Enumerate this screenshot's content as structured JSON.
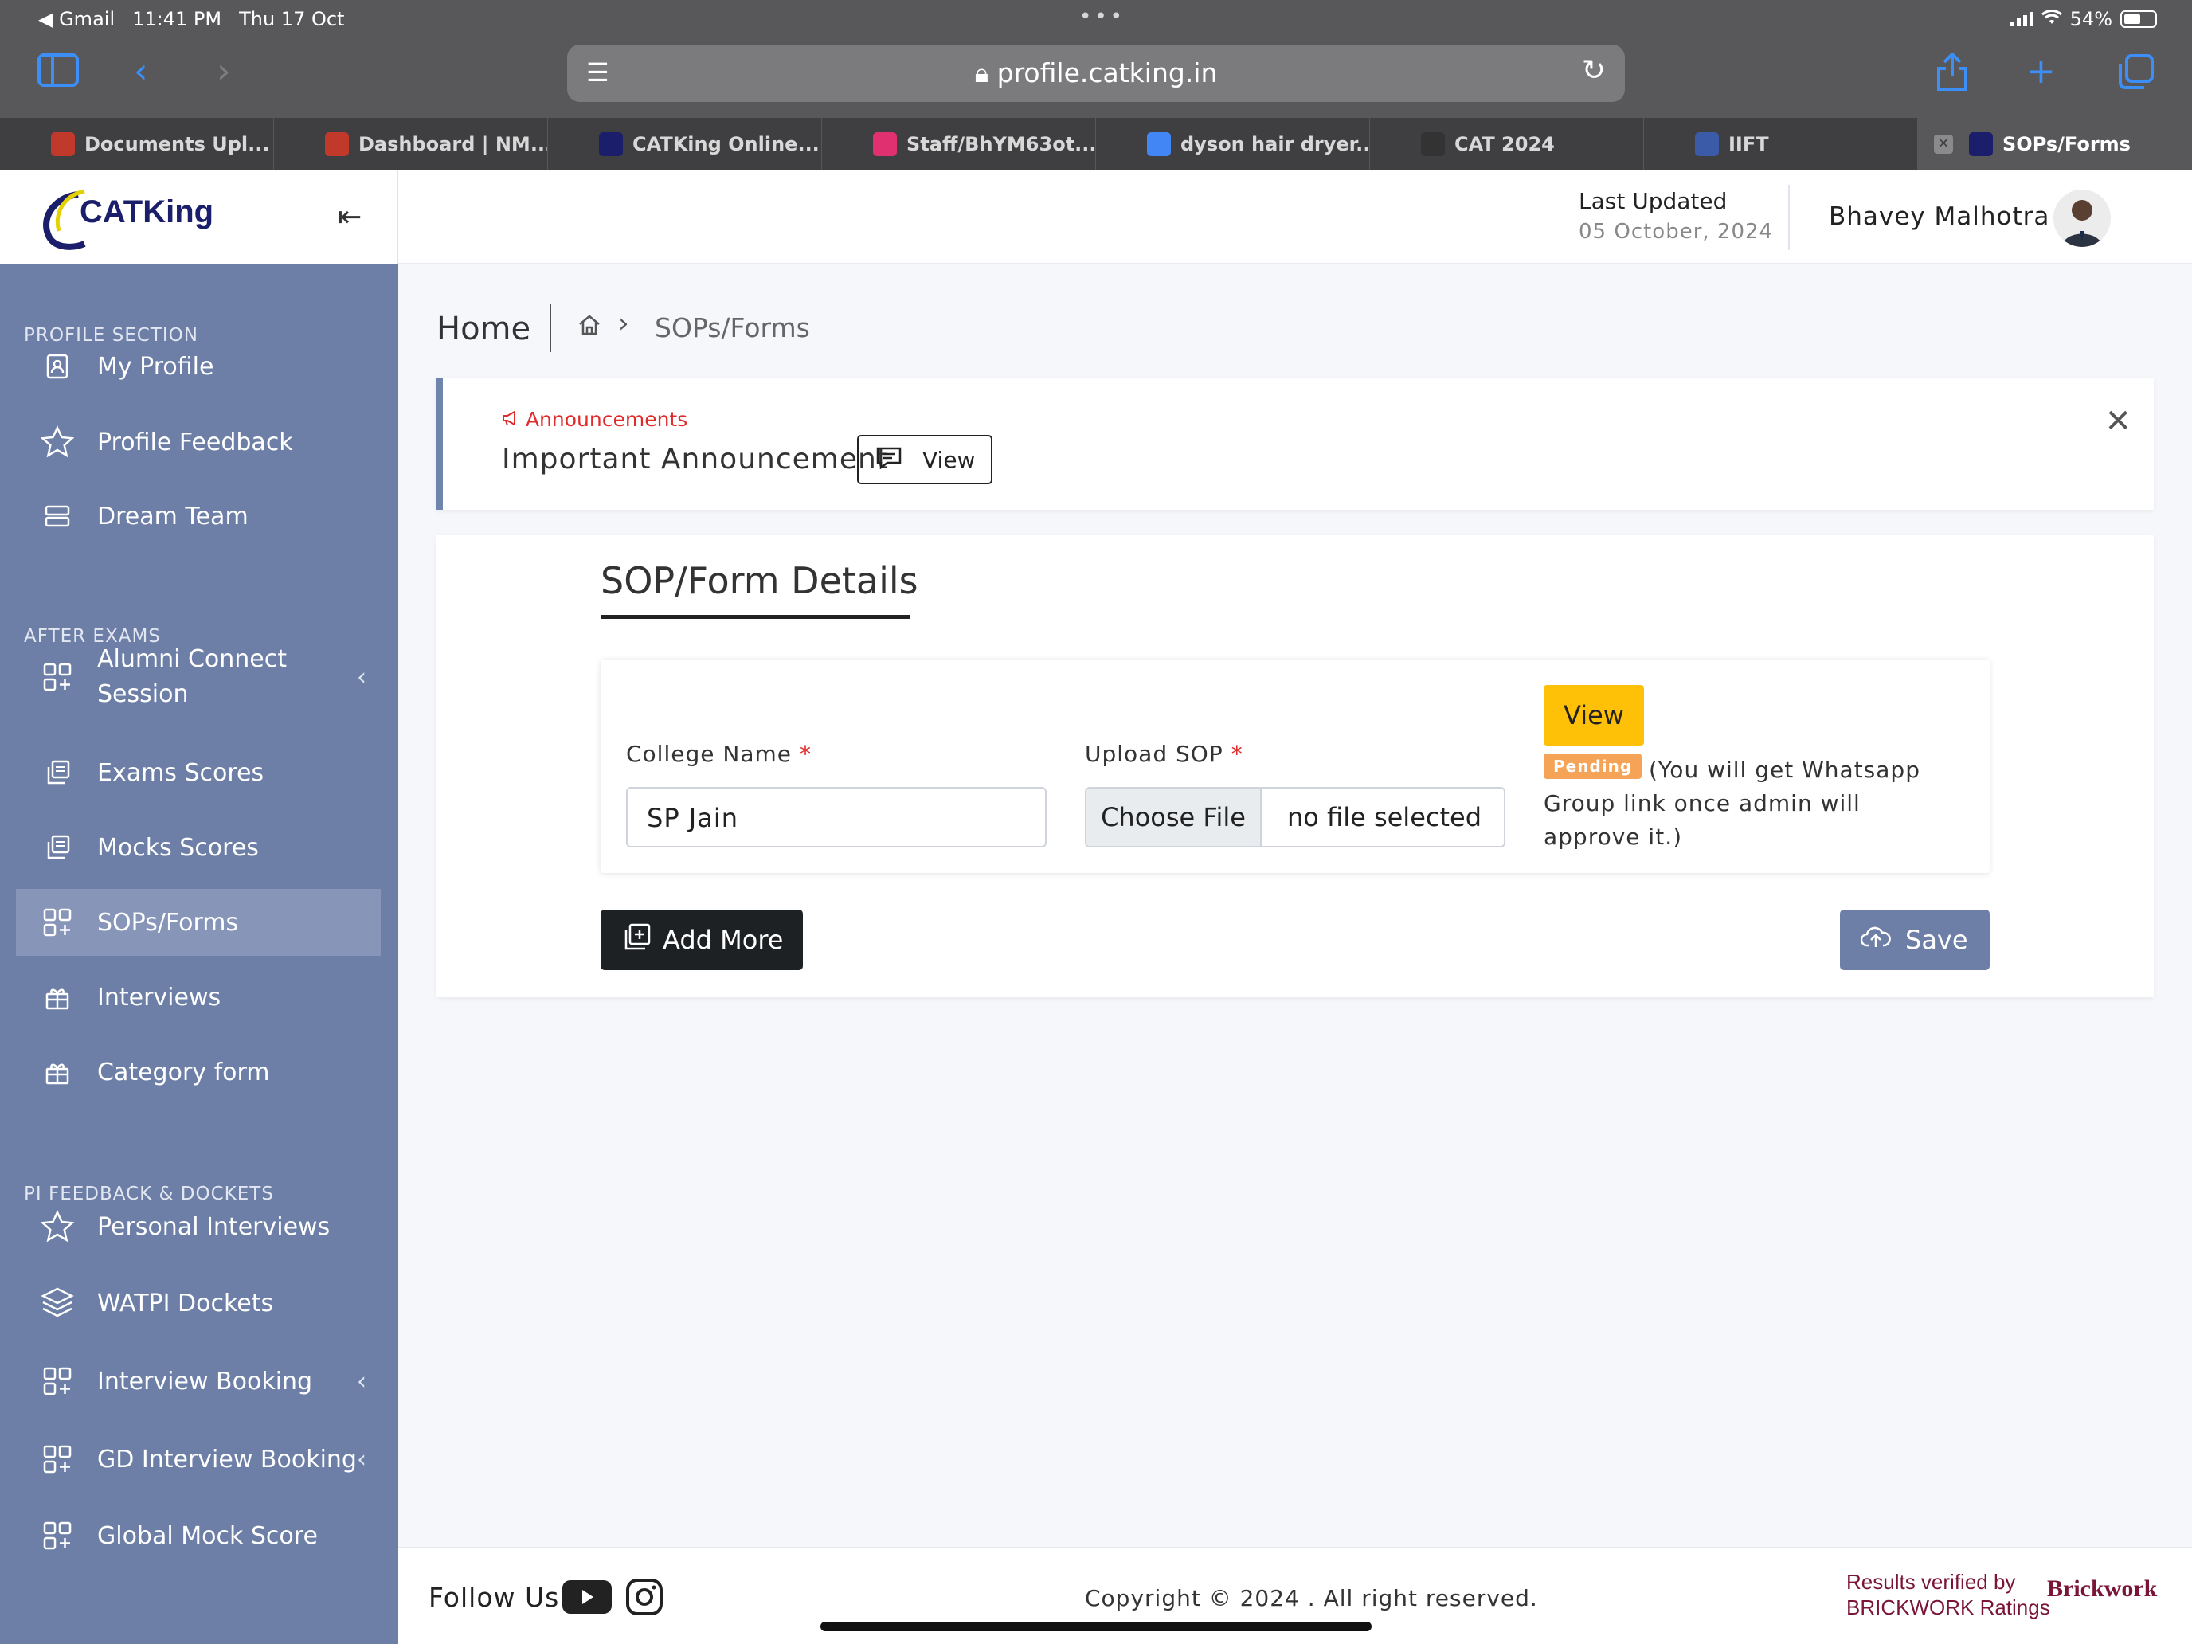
{
  "status_bar": {
    "back_app": "◀ Gmail",
    "time": "11:41 PM",
    "date": "Thu 17 Oct",
    "battery": "54%"
  },
  "browser": {
    "url": "profile.catking.in",
    "tabs": [
      {
        "title": "Documents Upl...",
        "fav_color": "#c0392b"
      },
      {
        "title": "Dashboard | NM...",
        "fav_color": "#c0392b"
      },
      {
        "title": "CATKing Online...",
        "fav_color": "#1b1f6b"
      },
      {
        "title": "Staff/BhYM63ot...",
        "fav_color": "#e0306f"
      },
      {
        "title": "dyson hair dryer...",
        "fav_color": "#4285f4"
      },
      {
        "title": "CAT 2024",
        "fav_color": "#333333"
      },
      {
        "title": "IIFT",
        "fav_color": "#3b5ba9"
      },
      {
        "title": "SOPs/Forms",
        "fav_color": "#1b1f6b",
        "active": true
      }
    ]
  },
  "brand": {
    "logo_text": "CATKing"
  },
  "sidebar": {
    "sections": [
      {
        "title": "PROFILE SECTION"
      },
      {
        "title": "AFTER EXAMS"
      },
      {
        "title": "PI FEEDBACK & DOCKETS"
      }
    ],
    "items": [
      {
        "label": "My Profile",
        "icon": "profile-icon"
      },
      {
        "label": "Profile Feedback",
        "icon": "star-icon"
      },
      {
        "label": "Dream Team",
        "icon": "server-icon"
      },
      {
        "label": "Alumni Connect Session",
        "icon": "grid-plus-icon"
      },
      {
        "label": "Exams Scores",
        "icon": "copy-icon"
      },
      {
        "label": "Mocks Scores",
        "icon": "copy-icon"
      },
      {
        "label": "SOPs/Forms",
        "icon": "grid-plus-icon",
        "active": true
      },
      {
        "label": "Interviews",
        "icon": "gift-icon"
      },
      {
        "label": "Category form",
        "icon": "gift-icon"
      },
      {
        "label": "Personal Interviews",
        "icon": "star-icon"
      },
      {
        "label": "WATPI Dockets",
        "icon": "layers-icon"
      },
      {
        "label": "Interview Booking",
        "icon": "grid-plus-icon"
      },
      {
        "label": "GD Interview Booking",
        "icon": "grid-plus-icon"
      },
      {
        "label": "Global Mock Score",
        "icon": "grid-plus-icon"
      }
    ]
  },
  "topbar": {
    "last_updated_label": "Last Updated",
    "last_updated_date": "05 October, 2024",
    "user_name": "Bhavey Malhotra"
  },
  "breadcrumb": {
    "home": "Home",
    "current": "SOPs/Forms"
  },
  "announcement": {
    "label": "Announcements",
    "title": "Important Announcement",
    "view_label": "View"
  },
  "form": {
    "title": "SOP/Form Details",
    "college_label": "College Name",
    "college_value": "SP Jain",
    "upload_label": "Upload SOP",
    "choose_file": "Choose File",
    "no_file": "no file selected",
    "view_label": "View",
    "status_badge": "Pending",
    "status_note": "(You will get Whatsapp Group link once admin will approve it.)",
    "required_mark": "*",
    "add_more": "Add More",
    "save": "Save"
  },
  "footer": {
    "follow": "Follow Us",
    "copyright": "Copyright © 2024 . All right reserved.",
    "verified_line1": "Results verified by",
    "verified_line2": "BRICKWORK Ratings",
    "brick_logo": "Brickwork"
  },
  "colors": {
    "sidebar": "#6d7fa6",
    "sidebar_active": "#8796b8",
    "accent_yellow": "#ffc107",
    "pending": "#f4a357",
    "required": "#e02b2b"
  }
}
